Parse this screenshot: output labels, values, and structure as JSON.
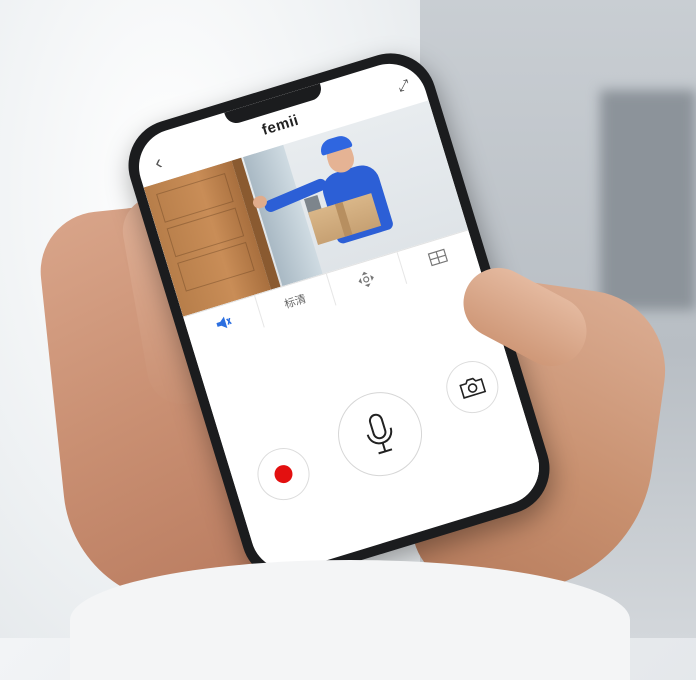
{
  "app": {
    "brand": "femii",
    "back_icon": "back-chevron-icon",
    "fullscreen_icon": "fullscreen-arrows-icon"
  },
  "toolbar": {
    "items": [
      {
        "icon": "speaker-icon",
        "label": ""
      },
      {
        "icon": "",
        "label": "标清"
      },
      {
        "icon": "pan-control-icon",
        "label": ""
      },
      {
        "icon": "grid-view-icon",
        "label": ""
      }
    ]
  },
  "controls": {
    "record_icon": "record-icon",
    "mic_icon": "microphone-icon",
    "snapshot_icon": "camera-icon"
  },
  "colors": {
    "record": "#e31010",
    "accent": "#2c5fd6",
    "screen_bg": "#ffffff",
    "phone_frame": "#1b1c1e"
  }
}
